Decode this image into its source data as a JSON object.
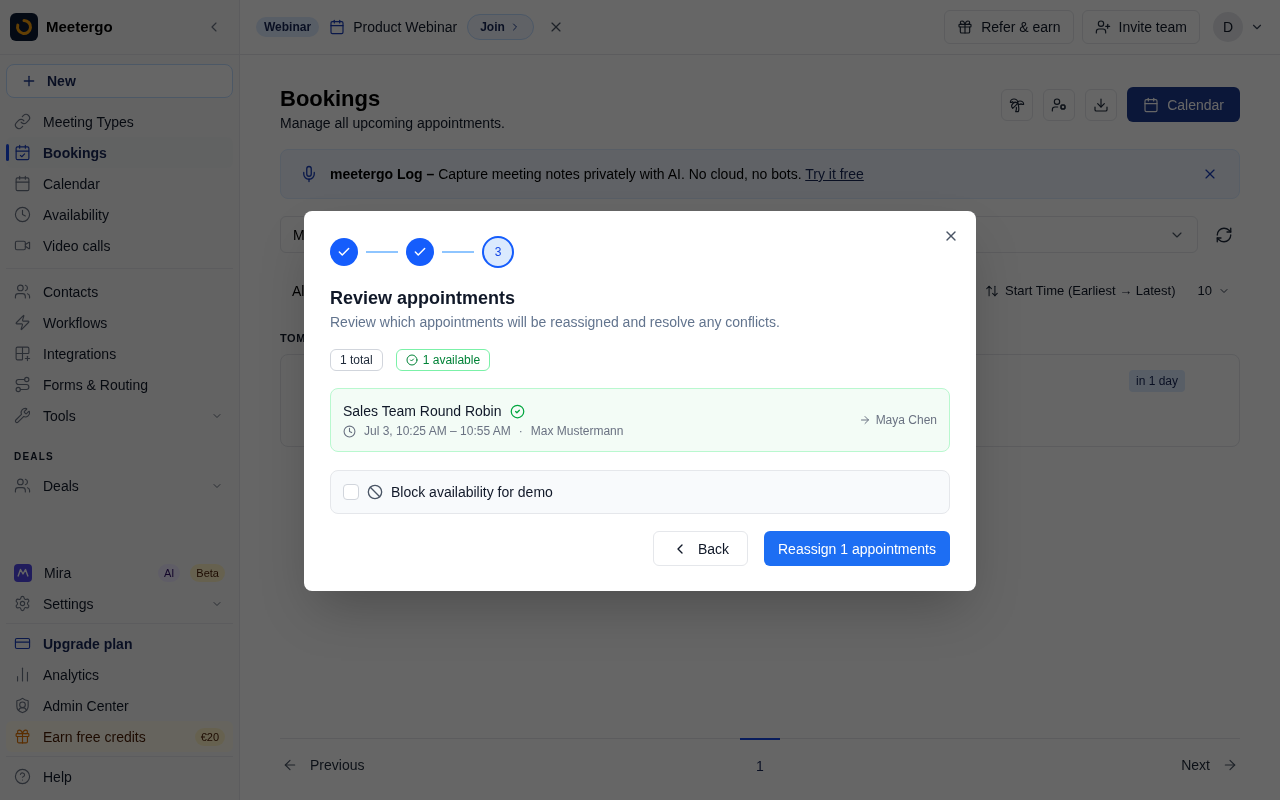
{
  "sidebar": {
    "brand": "Meetergo",
    "new_button": "New",
    "sections": [
      {
        "items": [
          {
            "label": "Meeting Types",
            "kind": "link",
            "selected": false
          },
          {
            "label": "Bookings",
            "kind": "link",
            "selected": true
          },
          {
            "label": "Calendar",
            "kind": "link",
            "selected": false
          },
          {
            "label": "Availability",
            "kind": "link",
            "selected": false
          },
          {
            "label": "Video calls",
            "kind": "link",
            "selected": false
          }
        ]
      },
      {
        "items": [
          {
            "label": "Contacts",
            "kind": "link",
            "selected": false
          },
          {
            "label": "Workflows",
            "kind": "link",
            "selected": false
          },
          {
            "label": "Integrations",
            "kind": "link",
            "selected": false
          },
          {
            "label": "Forms & Routing",
            "kind": "link",
            "selected": false
          },
          {
            "label": "Tools",
            "kind": "menu",
            "selected": false
          }
        ]
      },
      {
        "heading": "DEALS",
        "items": [
          {
            "label": "Deals",
            "kind": "menu",
            "selected": false
          }
        ]
      }
    ],
    "footer_sections": [
      {
        "items": [
          {
            "label": "Mira",
            "kind": "link",
            "selected": false,
            "badges": [
              {
                "text": "AI",
                "kind": "ai"
              },
              {
                "text": "Beta",
                "kind": "beta"
              }
            ]
          },
          {
            "label": "Settings",
            "kind": "menu",
            "selected": false
          }
        ]
      },
      {
        "items": [
          {
            "label": "Upgrade plan",
            "kind": "upgrade",
            "selected": false
          },
          {
            "label": "Analytics",
            "kind": "link",
            "selected": false
          },
          {
            "label": "Admin Center",
            "kind": "link",
            "selected": false
          },
          {
            "label": "Earn free credits",
            "kind": "reward",
            "selected": false,
            "badges": [
              {
                "text": "€20",
                "kind": "reward"
              }
            ]
          }
        ]
      },
      {
        "items": [
          {
            "label": "Help",
            "kind": "link",
            "selected": false
          }
        ]
      }
    ]
  },
  "top_bar": {
    "event_badge": "Webinar",
    "event_title": "Product Webinar",
    "join_button": "Join",
    "buttons": [
      {
        "label": "Refer & earn"
      },
      {
        "label": "Invite team"
      }
    ],
    "avatar": "D"
  },
  "page": {
    "title": "Bookings",
    "subtitle": "Manage all upcoming appointments.",
    "calendar_button": "Calendar"
  },
  "banner": {
    "text": "**meetergo Log –** Capture meeting notes privately with AI. No cloud, no bots.",
    "link": "Try it free"
  },
  "filters": {
    "select_value": "M",
    "tab": "Al",
    "sort": "Start Time (Earliest → Latest)",
    "page_size": "10"
  },
  "bookings": {
    "group_heading": "TOM",
    "cards": [
      {
        "badge": "in 1 day"
      }
    ]
  },
  "pagination": {
    "previous": "Previous",
    "pages": [
      {
        "label": "1",
        "selected": true
      }
    ],
    "next": "Next"
  },
  "modal": {
    "steps": [
      {
        "completed": true,
        "current": false
      },
      {
        "completed": true,
        "current": false
      },
      {
        "label": "3",
        "completed": false,
        "current": true
      }
    ],
    "title": "Review appointments",
    "description": "Review which appointments will be reassigned and resolve any conflicts.",
    "counts": [
      {
        "text": "1 total",
        "kind": "total"
      },
      {
        "text": "1 available",
        "kind": "available"
      }
    ],
    "appointments": [
      {
        "title": "Sales Team Round Robin",
        "available": true,
        "time": "Jul 3, 10:25 AM – 10:55 AM",
        "separator": "·",
        "host": "Max Mustermann",
        "new_host": "Maya Chen"
      }
    ],
    "block_option": {
      "label": "Block availability for demo",
      "checked": false
    },
    "back_button": "Back",
    "submit_button": "Reassign 1 appointments"
  }
}
